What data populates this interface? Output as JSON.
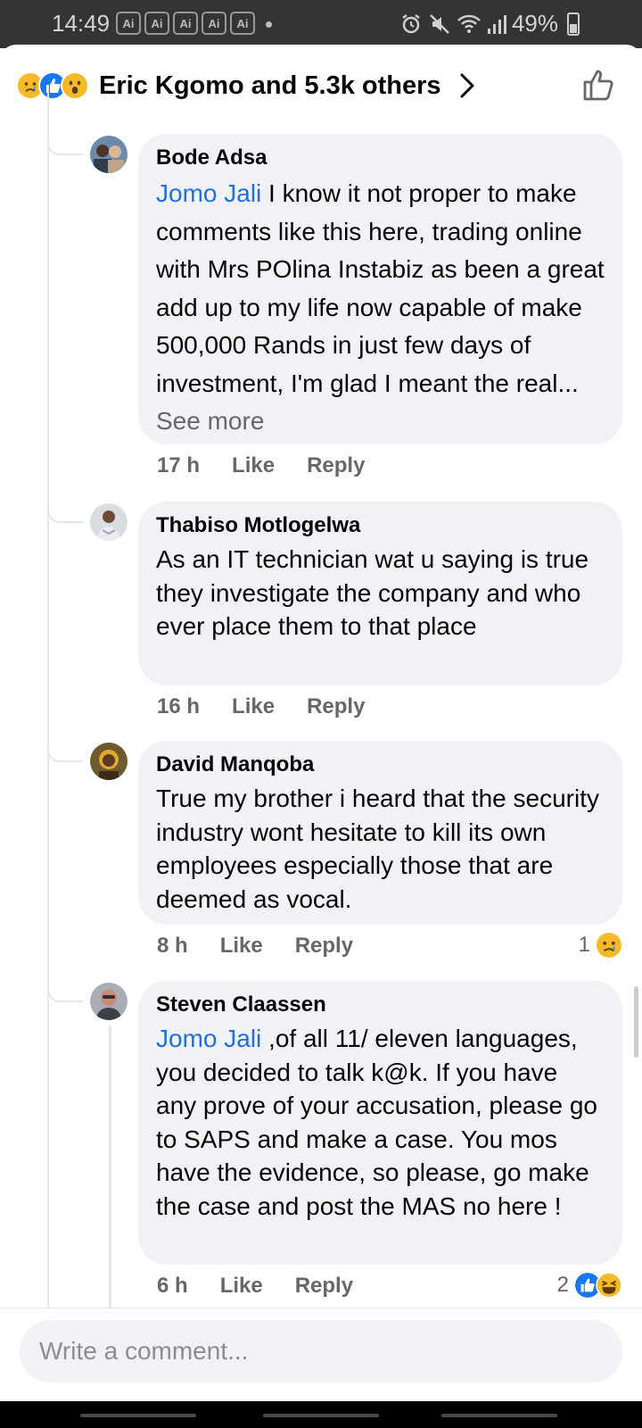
{
  "status_bar": {
    "time": "14:49",
    "ai_badges": [
      "Ai",
      "Ai",
      "Ai",
      "Ai",
      "Ai"
    ],
    "battery": "49%"
  },
  "header": {
    "reaction_icons": [
      "sad-reaction-icon",
      "like-reaction-icon",
      "wow-reaction-icon"
    ],
    "reactors_text": "Eric Kgomo and 5.3k others"
  },
  "comments": [
    {
      "author": "Bode Adsa",
      "mention": "Jomo Jali",
      "text": " I know it not proper to make comments like this here, trading online with Mrs POlina Instabiz as been a great add up to my life now capable of make 500,000 Rands in just few days of investment, I'm glad I meant the real...",
      "see_more": " See more",
      "time": "17 h",
      "like": "Like",
      "reply": "Reply"
    },
    {
      "author": "Thabiso Motlogelwa",
      "mention": "",
      "text": "As an IT technician wat u saying is true they investigate the company and who ever place them to that place",
      "time": "16 h",
      "like": "Like",
      "reply": "Reply"
    },
    {
      "author": "David Manqoba",
      "mention": "",
      "text": "True my brother i heard  that  the security  industry  wont hesitate  to kill its own employees  especially those that are deemed  as vocal.",
      "time": "8 h",
      "like": "Like",
      "reply": "Reply",
      "reaction_count": "1"
    },
    {
      "author": "Steven Claassen",
      "mention": "Jomo Jali",
      "text": " ,of all 11/ eleven languages,  you decided to talk k@k. If you have any prove of your accusation,  please go to SAPS and make a case. You mos have the evidence,  so please, go make the case and post the MAS no here !",
      "time": "6 h",
      "like": "Like",
      "reply": "Reply",
      "reaction_count": "2"
    }
  ],
  "composer": {
    "placeholder": "Write a comment..."
  },
  "colors": {
    "mention": "#216fdb",
    "bubble": "#f0f2f5",
    "meta": "#65676b",
    "like_blue": "#1877f2",
    "reaction_yellow": "#f7b928"
  }
}
